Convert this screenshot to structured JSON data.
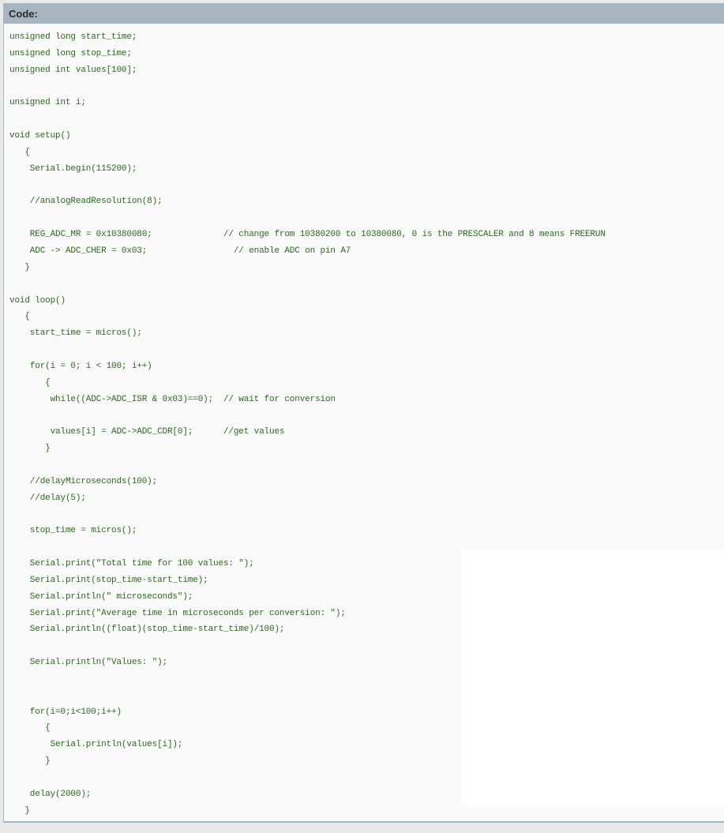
{
  "code_block": {
    "header_label": "Code:",
    "lines": [
      "unsigned long start_time;",
      "unsigned long stop_time;",
      "unsigned int values[100];",
      "",
      "unsigned int i;",
      "",
      "void setup()",
      "   {",
      "    Serial.begin(115200);",
      "",
      "    //analogReadResolution(8);",
      "",
      "    REG_ADC_MR = 0x10380080;              // change from 10380200 to 10380080, 0 is the PRESCALER and 8 means FREERUN",
      "    ADC -> ADC_CHER = 0x03;                 // enable ADC on pin A7",
      "   }",
      "",
      "void loop()",
      "   {",
      "    start_time = micros();",
      "",
      "    for(i = 0; i < 100; i++)",
      "       {",
      "        while((ADC->ADC_ISR & 0x03)==0);  // wait for conversion",
      "",
      "        values[i] = ADC->ADC_CDR[0];      //get values",
      "       }",
      "",
      "    //delayMicroseconds(100);",
      "    //delay(5);",
      "",
      "    stop_time = micros();",
      "",
      "    Serial.print(\"Total time for 100 values: \");",
      "    Serial.print(stop_time-start_time);",
      "    Serial.println(\" microseconds\");",
      "    Serial.print(\"Average time in microseconds per conversion: \");",
      "    Serial.println((float)(stop_time-start_time)/100);",
      "",
      "    Serial.println(\"Values: \");",
      "",
      "",
      "    for(i=0;i<100;i++)",
      "       {",
      "        Serial.println(values[i]);",
      "       }",
      "",
      "    delay(2000);",
      "   }"
    ]
  },
  "colors": {
    "header_background": "#a6b5bf",
    "header_text": "#2b2b2b",
    "code_background": "#fafafa",
    "code_text": "#2a6a1c",
    "page_background": "#e9e9e9"
  }
}
